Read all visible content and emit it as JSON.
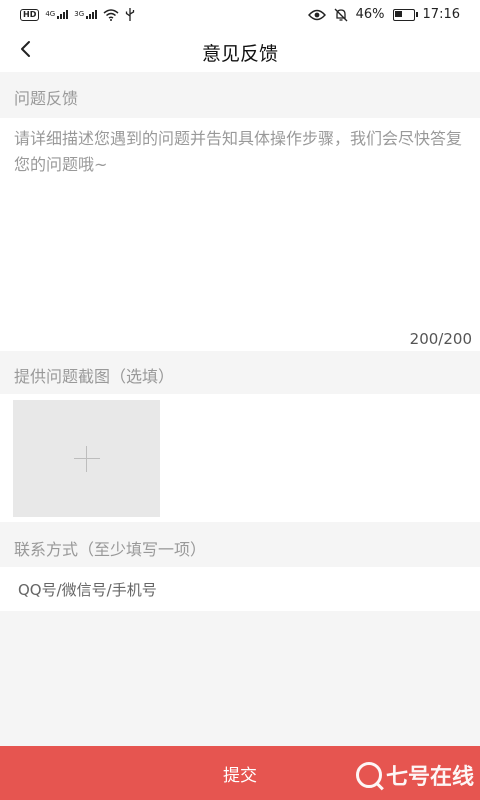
{
  "status_bar": {
    "hd_badge": "HD",
    "network_1": "4G",
    "network_2": "3G",
    "battery_percent": "46%",
    "battery_level": 0.46,
    "time": "17:16"
  },
  "header": {
    "title": "意见反馈"
  },
  "feedback": {
    "section_label": "问题反馈",
    "placeholder": "请详细描述您遇到的问题并告知具体操作步骤，我们会尽快答复您的问题哦~",
    "value": "",
    "counter": "200/200"
  },
  "screenshot": {
    "section_label": "提供问题截图（选填）"
  },
  "contact": {
    "section_label": "联系方式（至少填写一项）",
    "placeholder": "QQ号/微信号/手机号",
    "value": ""
  },
  "submit": {
    "label": "提交"
  },
  "watermark": {
    "text": "七号在线"
  },
  "colors": {
    "accent": "#e65550",
    "background": "#f5f5f5",
    "panel": "#ffffff",
    "placeholder": "#999999"
  }
}
